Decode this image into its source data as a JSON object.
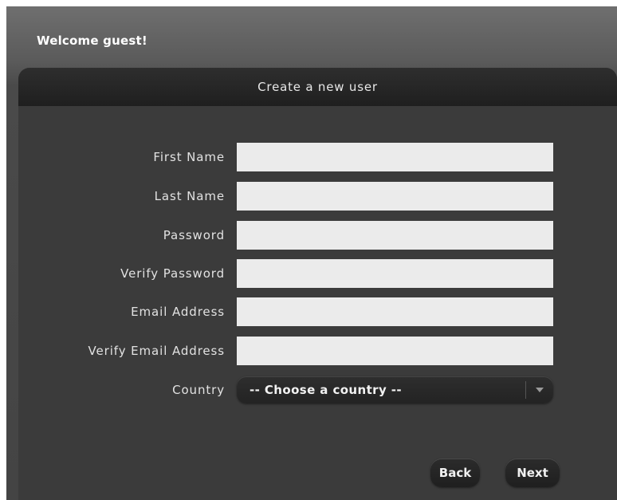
{
  "header": {
    "welcome": "Welcome guest!"
  },
  "panel": {
    "title": "Create a new user"
  },
  "form": {
    "fields": [
      {
        "label": "First Name",
        "value": ""
      },
      {
        "label": "Last Name",
        "value": ""
      },
      {
        "label": "Password",
        "value": ""
      },
      {
        "label": "Verify Password",
        "value": ""
      },
      {
        "label": "Email Address",
        "value": ""
      },
      {
        "label": "Verify Email Address",
        "value": ""
      }
    ],
    "country": {
      "label": "Country",
      "selected": "-- Choose a country --",
      "arrow_icon": "chevron-down-icon"
    }
  },
  "buttons": {
    "back": "Back",
    "next": "Next"
  },
  "colors": {
    "panel_bg": "#3b3b3b",
    "header_bg": "#252525",
    "input_bg": "#ebebeb",
    "text": "#e2e2e2"
  }
}
